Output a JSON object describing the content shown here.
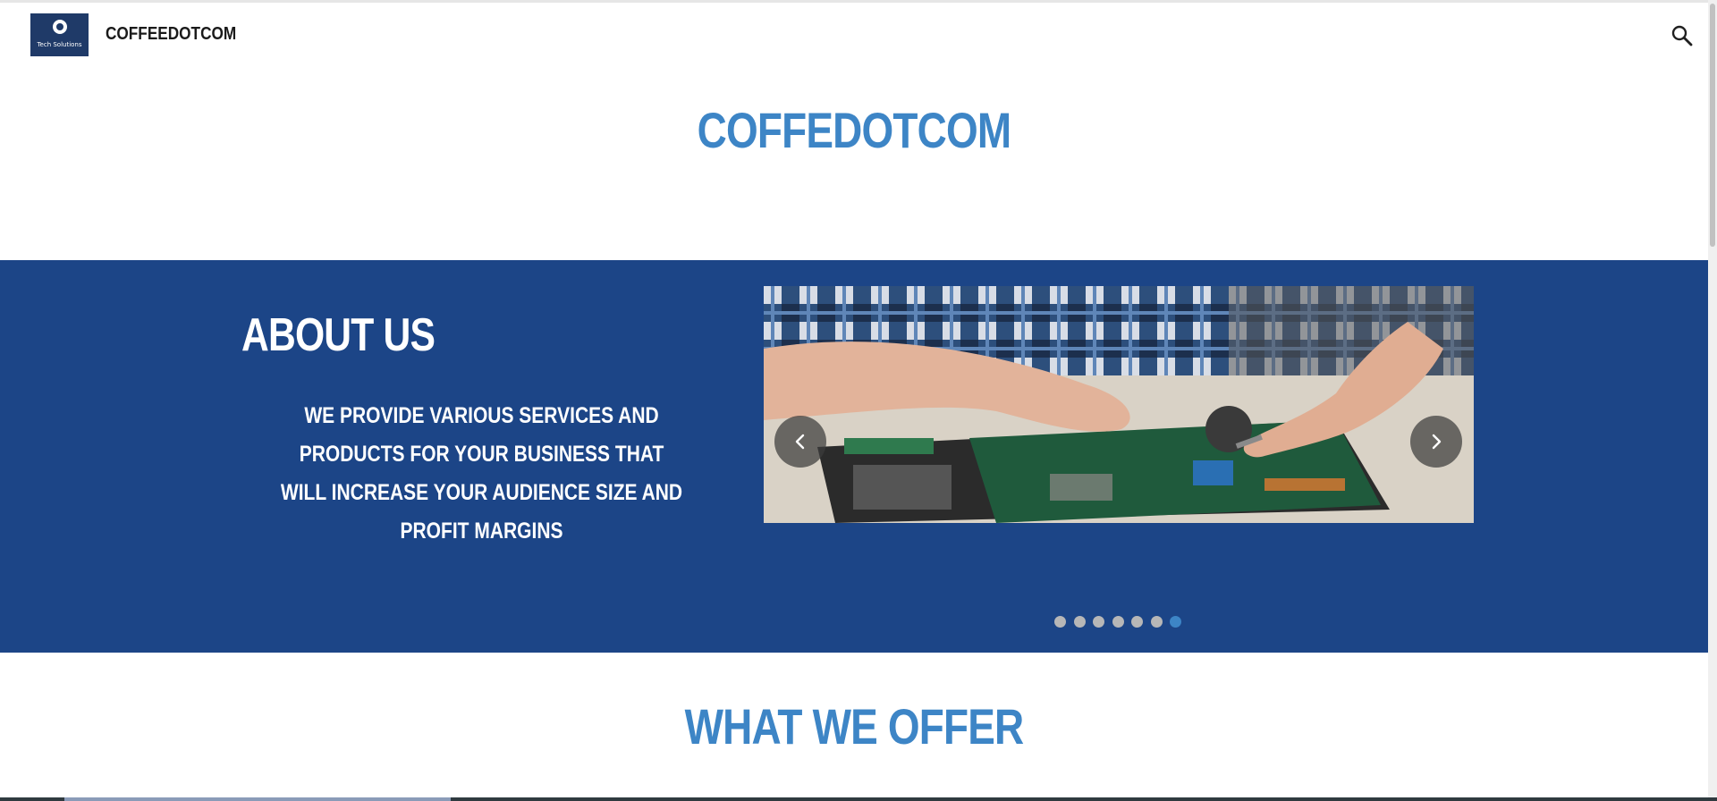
{
  "header": {
    "logo_text": "Tech Solutions",
    "site_name": "COFFEEDOTCOM"
  },
  "hero": {
    "title": "COFFEDOTCOM"
  },
  "about": {
    "heading": "ABOUT US",
    "text": "WE PROVIDE VARIOUS SERVICES AND PRODUCTS  FOR YOUR BUSINESS THAT WILL INCREASE YOUR AUDIENCE SIZE AND PROFIT MARGINS",
    "carousel": {
      "slide_count": 7,
      "active_slide": 7
    }
  },
  "offer": {
    "title": "WHAT WE OFFER"
  },
  "colors": {
    "brand_blue": "#3d85c6",
    "section_bg": "#1c4587",
    "logo_bg": "#1f3a68"
  },
  "icons": {
    "search": "search-icon",
    "prev": "chevron-left-icon",
    "next": "chevron-right-icon"
  }
}
